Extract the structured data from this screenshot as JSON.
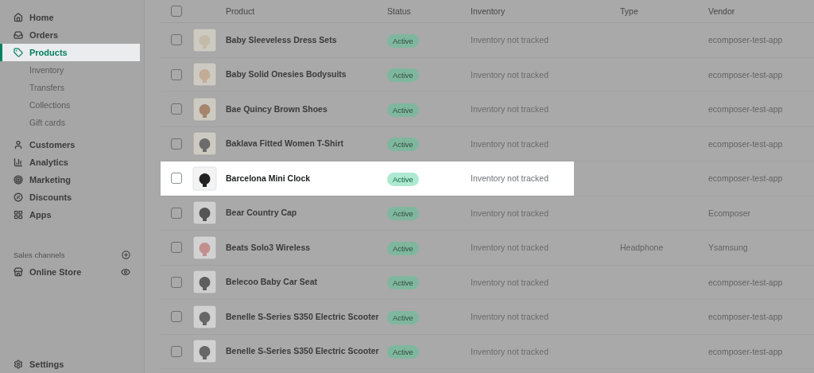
{
  "sidebar": {
    "items": [
      {
        "label": "Home",
        "highlighted": false
      },
      {
        "label": "Orders",
        "highlighted": false
      },
      {
        "label": "Products",
        "highlighted": true,
        "children": [
          {
            "label": "Inventory"
          },
          {
            "label": "Transfers"
          },
          {
            "label": "Collections"
          },
          {
            "label": "Gift cards"
          }
        ]
      },
      {
        "label": "Customers",
        "highlighted": false
      },
      {
        "label": "Analytics",
        "highlighted": false
      },
      {
        "label": "Marketing",
        "highlighted": false
      },
      {
        "label": "Discounts",
        "highlighted": false
      },
      {
        "label": "Apps",
        "highlighted": false
      }
    ],
    "sales_channels": {
      "heading": "Sales channels",
      "items": [
        {
          "label": "Online Store"
        }
      ]
    },
    "settings": {
      "label": "Settings"
    }
  },
  "table": {
    "columns": [
      "Product",
      "Status",
      "Inventory",
      "Type",
      "Vendor"
    ],
    "select_all": {
      "checked": false
    },
    "rows": [
      {
        "product": "Baby Sleeveless Dress Sets",
        "checked": false,
        "status": "Active",
        "inventory": "Inventory not tracked",
        "vendor": "ecomposer-test-app",
        "highlighted": false
      },
      {
        "product": "Baby Solid Onesies Bodysuits",
        "checked": false,
        "status": "Active",
        "inventory": "Inventory not tracked",
        "vendor": "ecomposer-test-app",
        "highlighted": false
      },
      {
        "product": "Bae Quincy Brown Shoes",
        "checked": false,
        "status": "Active",
        "inventory": "Inventory not tracked",
        "vendor": "ecomposer-test-app",
        "highlighted": false
      },
      {
        "product": "Baklava Fitted Women T-Shirt",
        "checked": false,
        "status": "Active",
        "inventory": "Inventory not tracked",
        "vendor": "ecomposer-test-app",
        "highlighted": false
      },
      {
        "product": "Barcelona Mini Clock",
        "checked": false,
        "status": "Active",
        "inventory": "Inventory not tracked",
        "vendor": "ecomposer-test-app",
        "highlighted": true
      },
      {
        "product": "Bear Country Cap",
        "checked": false,
        "status": "Active",
        "inventory": "Inventory not tracked",
        "vendor": "Ecomposer",
        "highlighted": false
      },
      {
        "product": "Beats Solo3 Wireless",
        "checked": false,
        "status": "Active",
        "inventory": "Inventory not tracked",
        "type": "Headphone",
        "vendor": "Ysamsung",
        "highlighted": false
      },
      {
        "product": "Belecoo Baby Car Seat",
        "checked": false,
        "status": "Active",
        "inventory": "Inventory not tracked",
        "vendor": "ecomposer-test-app",
        "highlighted": false
      },
      {
        "product": "Benelle S-Series S350 Electric Scooter",
        "checked": false,
        "status": "Active",
        "inventory": "Inventory not tracked",
        "vendor": "ecomposer-test-app",
        "highlighted": false
      },
      {
        "product": "Benelle S-Series S350 Electric Scooter",
        "checked": false,
        "status": "Active",
        "inventory": "Inventory not tracked",
        "vendor": "ecomposer-test-app",
        "highlighted": false
      }
    ]
  }
}
